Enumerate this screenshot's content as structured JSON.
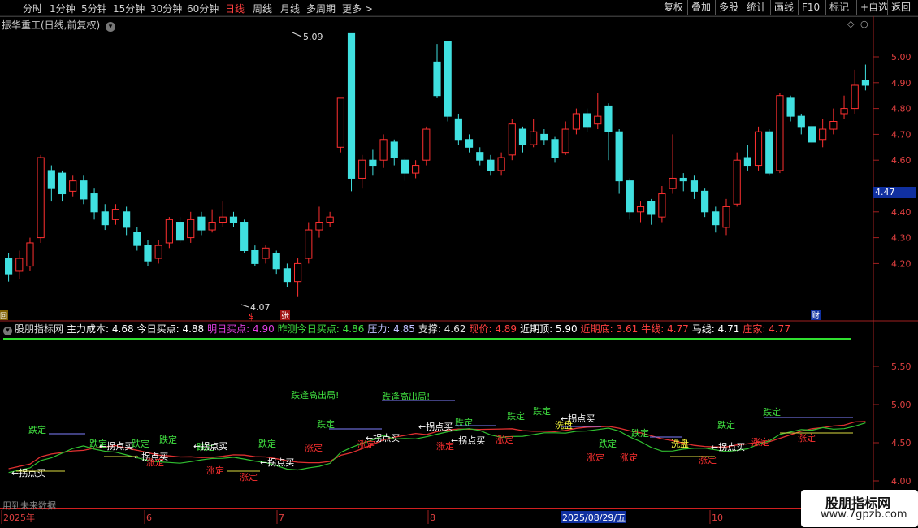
{
  "toolbar": {
    "periods": [
      "分时",
      "1分钟",
      "5分钟",
      "15分钟",
      "30分钟",
      "60分钟",
      "日线",
      "周线",
      "月线",
      "多周期",
      "更多"
    ],
    "active_period": "日线",
    "right_buttons": [
      "复权",
      "叠加",
      "多股",
      "统计",
      "画线",
      "F10",
      "标记",
      "+自选",
      "返回"
    ]
  },
  "chart_title": "振华重工(日线,前复权)",
  "price_axis": [
    "5.00",
    "4.90",
    "4.80",
    "4.70",
    "4.60",
    "4.40",
    "4.30",
    "4.20"
  ],
  "current_price_tag": "4.47",
  "annotations": {
    "high": "5.09",
    "low": "4.07",
    "zhang": "张",
    "cai": "财",
    "dollar": "$",
    "hui": "回"
  },
  "indicator": {
    "name": "股朋指标网",
    "items": [
      {
        "text": "主力成本: 4.68",
        "color": "#ffffff"
      },
      {
        "text": "今日买点: 4.88",
        "color": "#ffffff"
      },
      {
        "text": "明日买点: 4.90",
        "color": "#e040e0"
      },
      {
        "text": "昨测今日买点: 4.86",
        "color": "#40e040"
      },
      {
        "text": "压力: 4.85",
        "color": "#c0c0ff"
      },
      {
        "text": "支撑: 4.62",
        "color": "#e0e0e0"
      },
      {
        "text": "现价: 4.89",
        "color": "#ff4040"
      },
      {
        "text": "近期顶: 5.90",
        "color": "#ffffff"
      },
      {
        "text": "近期底: 3.61",
        "color": "#ff4040"
      },
      {
        "text": "牛线: 4.77",
        "color": "#ff4040"
      },
      {
        "text": "马线: 4.71",
        "color": "#ffffff"
      },
      {
        "text": "庄家: 4.77",
        "color": "#ff4040"
      }
    ],
    "axis": [
      "5.50",
      "5.00",
      "4.50",
      "4.00"
    ]
  },
  "signals": {
    "die": "跌定",
    "zhang": "涨定",
    "gdck": "跌逢高出局!",
    "zaidian": "←拐点买",
    "xi": "洗盘"
  },
  "dates": [
    "2025年",
    "6",
    "7",
    "8",
    "2025/08/29/五",
    "10"
  ],
  "future_note": "用到未来数据",
  "watermark": {
    "line1": "股朋指标网",
    "line2": "www.7gpzb.com"
  },
  "colors": {
    "up": "#ff3030",
    "down": "#40e0e0",
    "green_line": "#30c030",
    "red_line": "#e03030"
  },
  "chart_data": {
    "type": "candlestick",
    "series": [
      {
        "values": [
          [
            4.22,
            4.16,
            4.24,
            4.13
          ],
          [
            4.17,
            4.22,
            4.25,
            4.14
          ],
          [
            4.19,
            4.28,
            4.3,
            4.17
          ],
          [
            4.3,
            4.61,
            4.62,
            4.28
          ],
          [
            4.56,
            4.49,
            4.58,
            4.44
          ],
          [
            4.55,
            4.47,
            4.56,
            4.44
          ],
          [
            4.48,
            4.52,
            4.54,
            4.46
          ],
          [
            4.52,
            4.45,
            4.54,
            4.43
          ],
          [
            4.47,
            4.4,
            4.49,
            4.37
          ],
          [
            4.4,
            4.35,
            4.43,
            4.33
          ],
          [
            4.37,
            4.41,
            4.43,
            4.35
          ],
          [
            4.4,
            4.34,
            4.42,
            4.31
          ],
          [
            4.32,
            4.27,
            4.34,
            4.25
          ],
          [
            4.27,
            4.21,
            4.29,
            4.19
          ],
          [
            4.22,
            4.27,
            4.29,
            4.2
          ],
          [
            4.28,
            4.37,
            4.38,
            4.26
          ],
          [
            4.36,
            4.29,
            4.38,
            4.28
          ],
          [
            4.3,
            4.37,
            4.4,
            4.28
          ],
          [
            4.38,
            4.33,
            4.4,
            4.31
          ],
          [
            4.33,
            4.36,
            4.41,
            4.32
          ],
          [
            4.36,
            4.38,
            4.44,
            4.34
          ],
          [
            4.38,
            4.36,
            4.4,
            4.34
          ],
          [
            4.36,
            4.25,
            4.37,
            4.24
          ],
          [
            4.25,
            4.2,
            4.27,
            4.19
          ],
          [
            4.22,
            4.26,
            4.27,
            4.2
          ],
          [
            4.24,
            4.18,
            4.25,
            4.16
          ],
          [
            4.18,
            4.13,
            4.2,
            4.11
          ],
          [
            4.13,
            4.2,
            4.22,
            4.07
          ],
          [
            4.22,
            4.33,
            4.36,
            4.2
          ],
          [
            4.33,
            4.36,
            4.42,
            4.3
          ],
          [
            4.36,
            4.38,
            4.4,
            4.34
          ],
          [
            4.65,
            4.84,
            4.84,
            4.63
          ],
          [
            5.09,
            4.53,
            5.09,
            4.48
          ],
          [
            4.53,
            4.6,
            4.62,
            4.49
          ],
          [
            4.6,
            4.58,
            4.64,
            4.54
          ],
          [
            4.6,
            4.68,
            4.7,
            4.57
          ],
          [
            4.67,
            4.61,
            4.68,
            4.58
          ],
          [
            4.6,
            4.55,
            4.61,
            4.52
          ],
          [
            4.55,
            4.58,
            4.6,
            4.53
          ],
          [
            4.6,
            4.72,
            4.73,
            4.58
          ],
          [
            4.98,
            4.85,
            5.05,
            4.84
          ],
          [
            5.06,
            4.77,
            5.06,
            4.75
          ],
          [
            4.76,
            4.68,
            4.78,
            4.66
          ],
          [
            4.68,
            4.65,
            4.7,
            4.63
          ],
          [
            4.63,
            4.6,
            4.65,
            4.58
          ],
          [
            4.6,
            4.56,
            4.62,
            4.54
          ],
          [
            4.56,
            4.61,
            4.63,
            4.54
          ],
          [
            4.62,
            4.74,
            4.76,
            4.6
          ],
          [
            4.72,
            4.66,
            4.73,
            4.63
          ],
          [
            4.66,
            4.71,
            4.76,
            4.65
          ],
          [
            4.7,
            4.68,
            4.72,
            4.66
          ],
          [
            4.68,
            4.61,
            4.69,
            4.59
          ],
          [
            4.63,
            4.72,
            4.75,
            4.62
          ],
          [
            4.72,
            4.78,
            4.8,
            4.7
          ],
          [
            4.78,
            4.73,
            4.8,
            4.71
          ],
          [
            4.74,
            4.77,
            4.86,
            4.72
          ],
          [
            4.81,
            4.71,
            4.82,
            4.6
          ],
          [
            4.71,
            4.52,
            4.72,
            4.47
          ],
          [
            4.52,
            4.4,
            4.53,
            4.37
          ],
          [
            4.4,
            4.42,
            4.44,
            4.36
          ],
          [
            4.44,
            4.39,
            4.45,
            4.35
          ],
          [
            4.38,
            4.47,
            4.5,
            4.36
          ],
          [
            4.49,
            4.53,
            4.7,
            4.47
          ],
          [
            4.53,
            4.52,
            4.55,
            4.48
          ],
          [
            4.52,
            4.48,
            4.54,
            4.45
          ],
          [
            4.48,
            4.4,
            4.49,
            4.38
          ],
          [
            4.4,
            4.35,
            4.42,
            4.32
          ],
          [
            4.34,
            4.42,
            4.45,
            4.31
          ],
          [
            4.43,
            4.6,
            4.63,
            4.42
          ],
          [
            4.61,
            4.58,
            4.66,
            4.56
          ],
          [
            4.58,
            4.71,
            4.73,
            4.56
          ],
          [
            4.71,
            4.55,
            4.72,
            4.54
          ],
          [
            4.56,
            4.85,
            4.86,
            4.55
          ],
          [
            4.84,
            4.77,
            4.85,
            4.75
          ],
          [
            4.77,
            4.73,
            4.78,
            4.7
          ],
          [
            4.73,
            4.67,
            4.75,
            4.66
          ],
          [
            4.68,
            4.72,
            4.76,
            4.65
          ],
          [
            4.72,
            4.75,
            4.8,
            4.7
          ],
          [
            4.78,
            4.8,
            4.85,
            4.76
          ],
          [
            4.8,
            4.89,
            4.95,
            4.78
          ],
          [
            4.91,
            4.89,
            4.97,
            4.87
          ]
        ]
      }
    ]
  }
}
